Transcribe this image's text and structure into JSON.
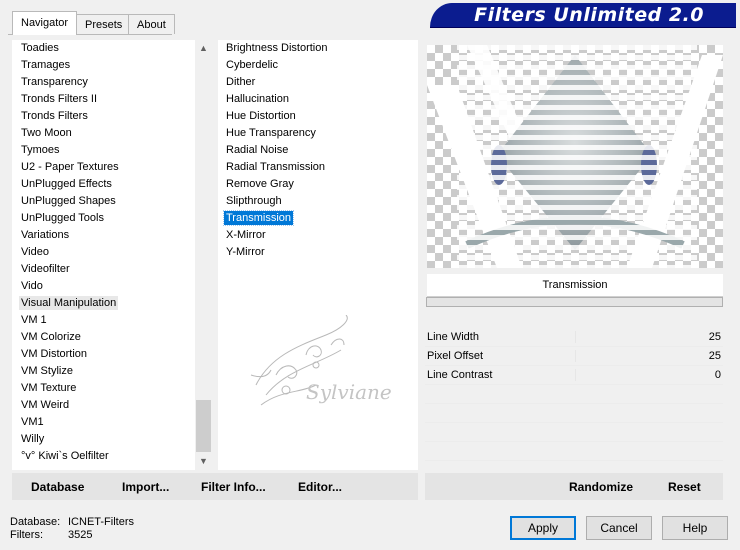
{
  "tabs": [
    "Navigator",
    "Presets",
    "About"
  ],
  "header": {
    "title": "Filters Unlimited 2.0"
  },
  "categories": [
    "Toadies",
    "Tramages",
    "Transparency",
    "Tronds Filters II",
    "Tronds Filters",
    "Two Moon",
    "Tymoes",
    "U2 - Paper Textures",
    "UnPlugged Effects",
    "UnPlugged Shapes",
    "UnPlugged Tools",
    "Variations",
    "Video",
    "Videofilter",
    "Vido",
    "Visual Manipulation",
    "VM 1",
    "VM Colorize",
    "VM Distortion",
    "VM Stylize",
    "VM Texture",
    "VM Weird",
    "VM1",
    "Willy",
    "°v° Kiwi`s Oelfilter"
  ],
  "selected_category": "Visual Manipulation",
  "filters": [
    "Brightness Distortion",
    "Cyberdelic",
    "Dither",
    "Hallucination",
    "Hue Distortion",
    "Hue Transparency",
    "Radial Noise",
    "Radial Transmission",
    "Remove Gray",
    "Slipthrough",
    "Transmission",
    "X-Mirror",
    "Y-Mirror"
  ],
  "selected_filter": "Transmission",
  "watermark": "Sylviane",
  "preview": {
    "filter_name": "Transmission"
  },
  "params": [
    {
      "label": "Line Width",
      "value": "25"
    },
    {
      "label": "Pixel Offset",
      "value": "25"
    },
    {
      "label": "Line Contrast",
      "value": "0"
    }
  ],
  "toolbar": {
    "database": "Database",
    "import": "Import...",
    "filter_info": "Filter Info...",
    "editor": "Editor...",
    "randomize": "Randomize",
    "reset": "Reset"
  },
  "status": {
    "database_label": "Database:",
    "database_value": "ICNET-Filters",
    "filters_label": "Filters:",
    "filters_value": "3525"
  },
  "buttons": {
    "apply": "Apply",
    "cancel": "Cancel",
    "help": "Help"
  },
  "colors": {
    "banner": "#0b1c8f",
    "selection": "#0078d7"
  }
}
